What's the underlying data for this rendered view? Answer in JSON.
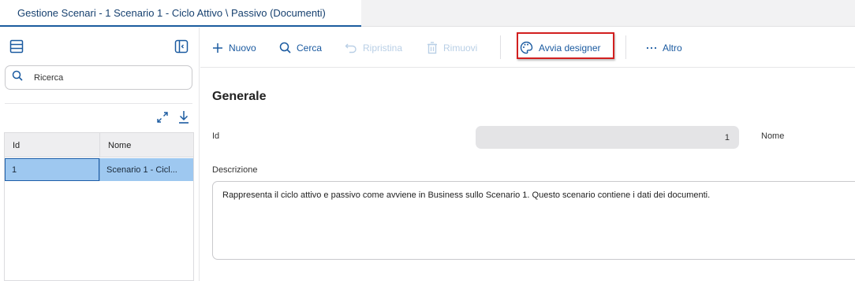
{
  "tab": {
    "title": "Gestione Scenari - 1 Scenario 1 - Ciclo Attivo \\ Passivo (Documenti)"
  },
  "sidebar": {
    "search_placeholder": "Ricerca",
    "grid": {
      "columns": [
        "Id",
        "Nome"
      ],
      "rows": [
        {
          "id": "1",
          "nome": "Scenario 1 - Cicl..."
        }
      ]
    }
  },
  "toolbar": {
    "new_label": "Nuovo",
    "search_label": "Cerca",
    "restore_label": "Ripristina",
    "remove_label": "Rimuovi",
    "designer_label": "Avvia designer",
    "more_label": "Altro"
  },
  "form": {
    "section_title": "Generale",
    "id_label": "Id",
    "id_value": "1",
    "name_label": "Nome",
    "description_label": "Descrizione",
    "description_value": "Rappresenta il ciclo attivo e passivo come avviene in Business sullo Scenario 1. Questo scenario contiene i dati dei documenti."
  },
  "colors": {
    "accent": "#1a5aa0",
    "selected_row": "#9ec8f0",
    "highlight_box": "#d21f1f",
    "disabled": "#b9cfe6"
  },
  "icons": [
    "list-icon",
    "panel-collapse-icon",
    "search-icon",
    "expand-icon",
    "download-icon",
    "plus-icon",
    "restore-icon",
    "trash-icon",
    "palette-icon",
    "more-dots-icon"
  ]
}
